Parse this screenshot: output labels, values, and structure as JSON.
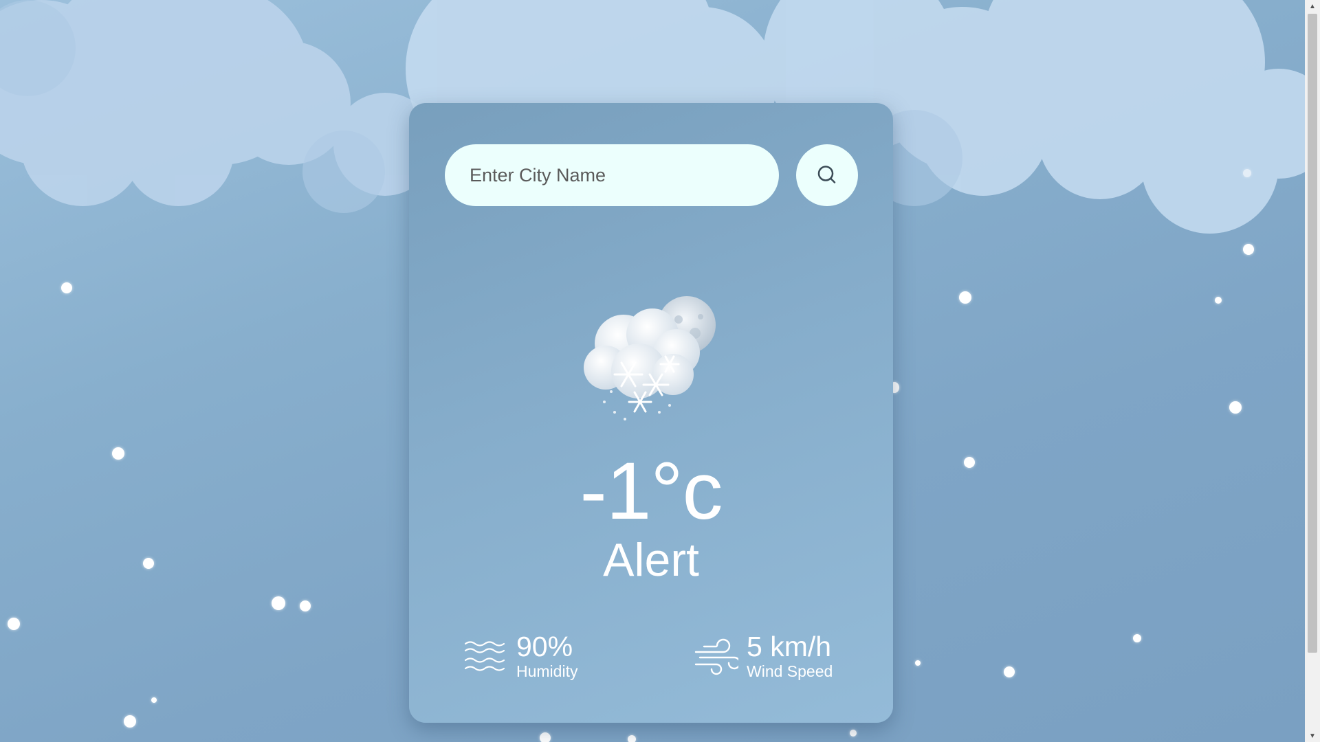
{
  "search": {
    "placeholder": "Enter City Name",
    "value": ""
  },
  "weather": {
    "temperature": "-1°c",
    "condition": "Alert",
    "icon": "snow-cloud-moon-icon"
  },
  "details": {
    "humidity": {
      "value": "90%",
      "label": "Humidity",
      "icon": "humidity-waves-icon"
    },
    "wind": {
      "value": "5 km/h",
      "label": "Wind Speed",
      "icon": "wind-icon"
    }
  },
  "colors": {
    "background": "#88afcd",
    "card": "#86adcb",
    "input": "#ecfffd",
    "text": "#ffffff"
  }
}
